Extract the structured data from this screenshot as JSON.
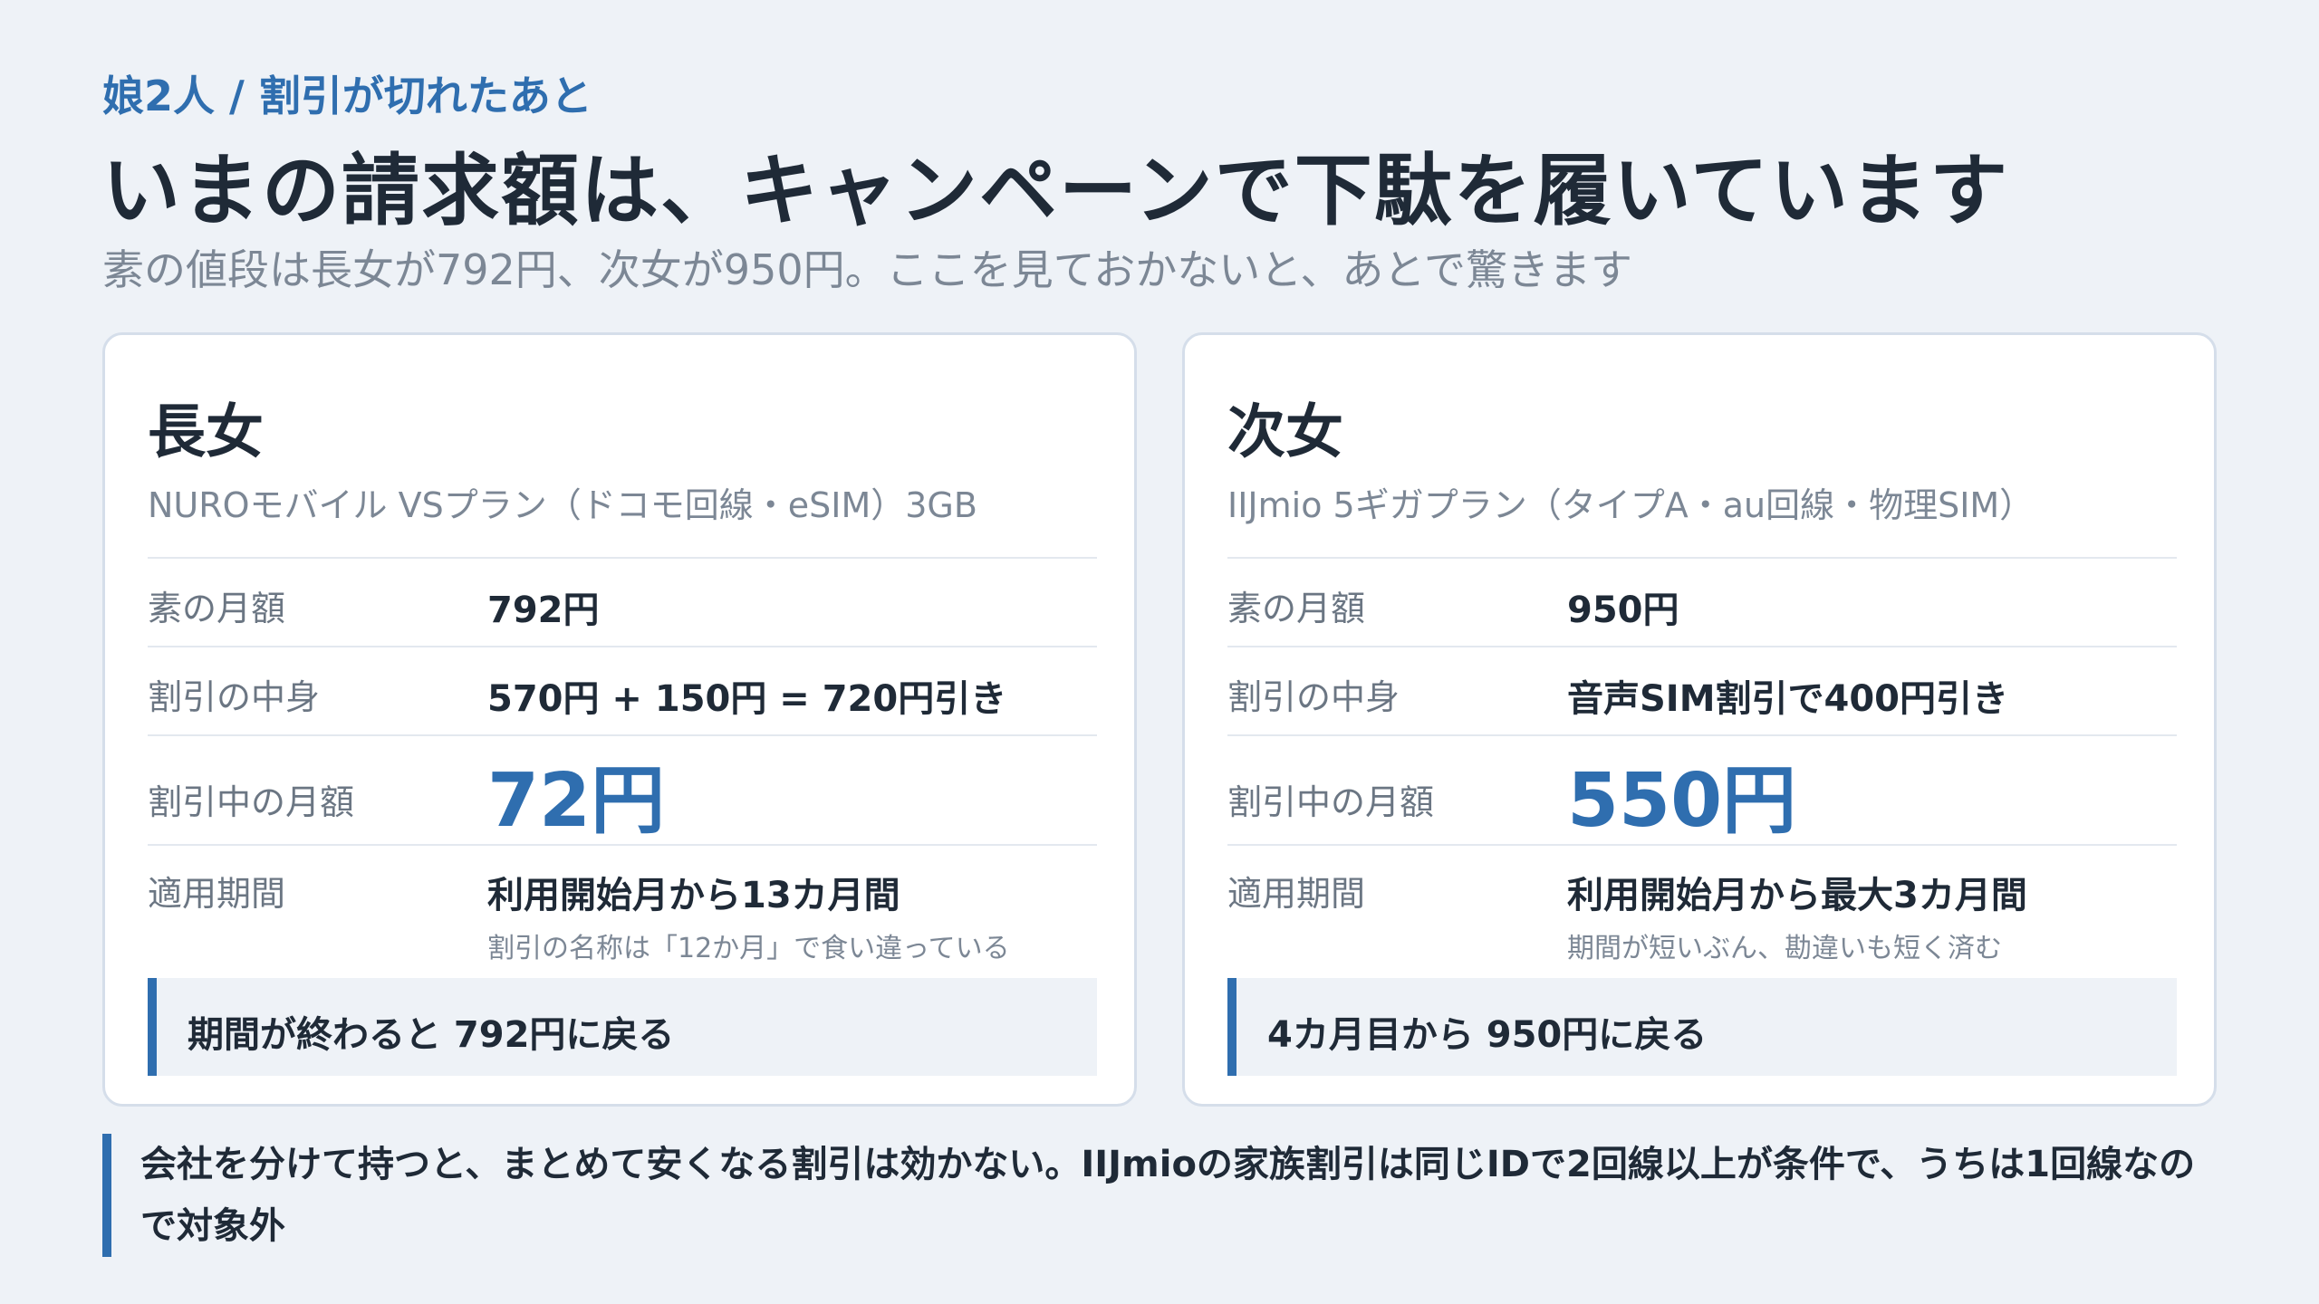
{
  "header": {
    "eyebrow": "娘2人 / 割引が切れたあと",
    "title": "いまの請求額は、キャンペーンで下駄を履いています",
    "subtitle": "素の値段は長女が792円、次女が950円。ここを見ておかないと、あとで驚きます"
  },
  "cards": [
    {
      "name": "長女",
      "plan": "NUROモバイル VSプラン（ドコモ回線・eSIM）3GB",
      "rows": [
        {
          "label": "素の月額",
          "value": "792円"
        },
        {
          "label": "割引の中身",
          "value": "570円 + 150円 = 720円引き"
        },
        {
          "label": "割引中の月額",
          "value": "72円"
        },
        {
          "label": "適用期間",
          "value": "利用開始月から13カ月間",
          "note": "割引の名称は「12か月」で食い違っている"
        }
      ],
      "callout": "期間が終わると 792円に戻る"
    },
    {
      "name": "次女",
      "plan": "IIJmio 5ギガプラン（タイプA・au回線・物理SIM）",
      "rows": [
        {
          "label": "素の月額",
          "value": "950円"
        },
        {
          "label": "割引の中身",
          "value": "音声SIM割引で400円引き"
        },
        {
          "label": "割引中の月額",
          "value": "550円"
        },
        {
          "label": "適用期間",
          "value": "利用開始月から最大3カ月間",
          "note": "期間が短いぶん、勘違いも短く済む"
        }
      ],
      "callout": "4カ月目から 950円に戻る"
    }
  ],
  "footnote": "会社を分けて持つと、まとめて安くなる割引は効かない。IIJmioの家族割引は同じIDで2回線以上が条件で、うちは1回線なので対象外",
  "colors": {
    "accent": "#2f6eaf",
    "background": "#eef2f7",
    "text": "#1f2a37",
    "muted": "#7c8795"
  }
}
